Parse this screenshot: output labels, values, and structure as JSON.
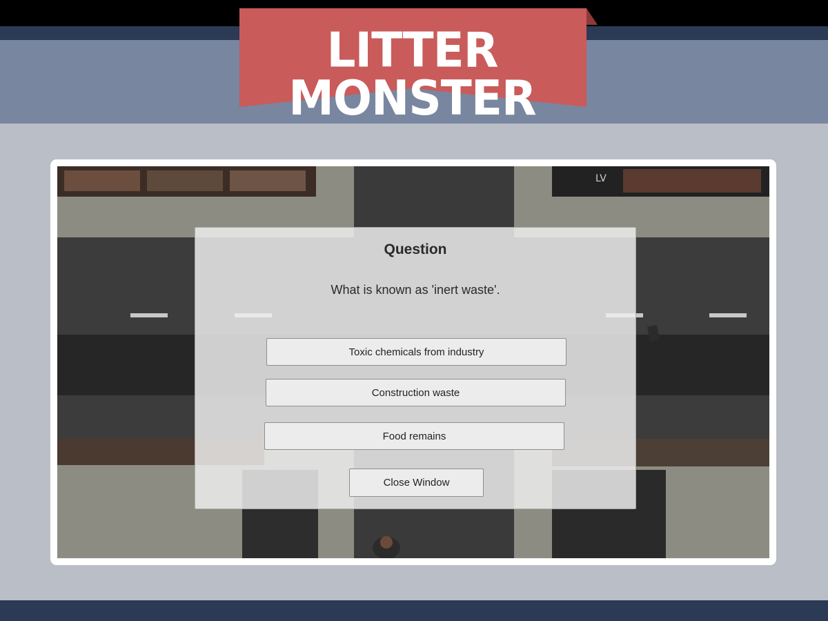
{
  "header": {
    "logo_text": "LITTER MONSTER"
  },
  "colors": {
    "banner": "#c95b5b",
    "header_band": "#7886a0",
    "navy": "#2b3a55",
    "page_bg": "#b9bec7"
  },
  "dialog": {
    "title": "Question",
    "question": "What is known as 'inert waste'.",
    "answers": [
      "Toxic chemicals from industry",
      "Construction waste",
      "Food remains"
    ],
    "close_label": "Close Window"
  }
}
